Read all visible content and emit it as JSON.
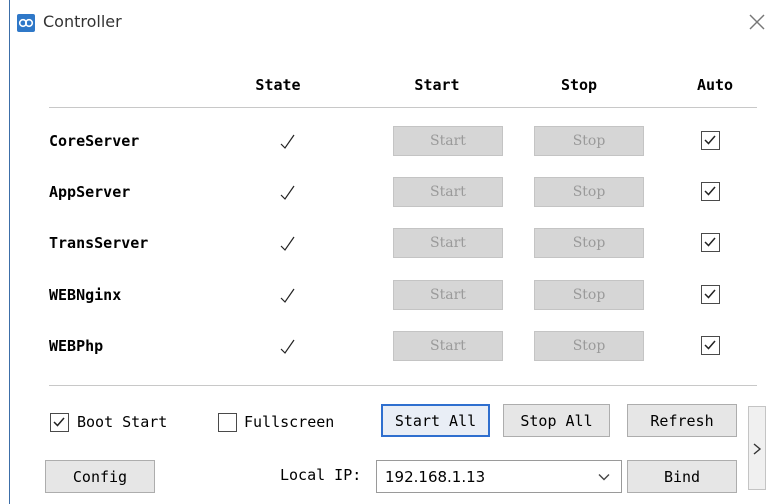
{
  "window": {
    "title": "Controller"
  },
  "headers": {
    "state": "State",
    "start": "Start",
    "stop": "Stop",
    "auto": "Auto"
  },
  "services": [
    {
      "name": "CoreServer",
      "start_label": "Start",
      "stop_label": "Stop",
      "auto": true
    },
    {
      "name": "AppServer",
      "start_label": "Start",
      "stop_label": "Stop",
      "auto": true
    },
    {
      "name": "TransServer",
      "start_label": "Start",
      "stop_label": "Stop",
      "auto": true
    },
    {
      "name": "WEBNginx",
      "start_label": "Start",
      "stop_label": "Stop",
      "auto": true
    },
    {
      "name": "WEBPhp",
      "start_label": "Start",
      "stop_label": "Stop",
      "auto": true
    }
  ],
  "options": {
    "boot_start": {
      "label": "Boot Start",
      "checked": true
    },
    "fullscreen": {
      "label": "Fullscreen",
      "checked": false
    }
  },
  "actions": {
    "start_all": "Start All",
    "stop_all": "Stop All",
    "refresh": "Refresh",
    "config": "Config",
    "bind": "Bind"
  },
  "local_ip": {
    "label": "Local IP:",
    "value": "192.168.1.13"
  },
  "colors": {
    "accent": "#2f6fcf",
    "disabled_button": "#d6d6d6",
    "icon": "#2f78c8"
  }
}
